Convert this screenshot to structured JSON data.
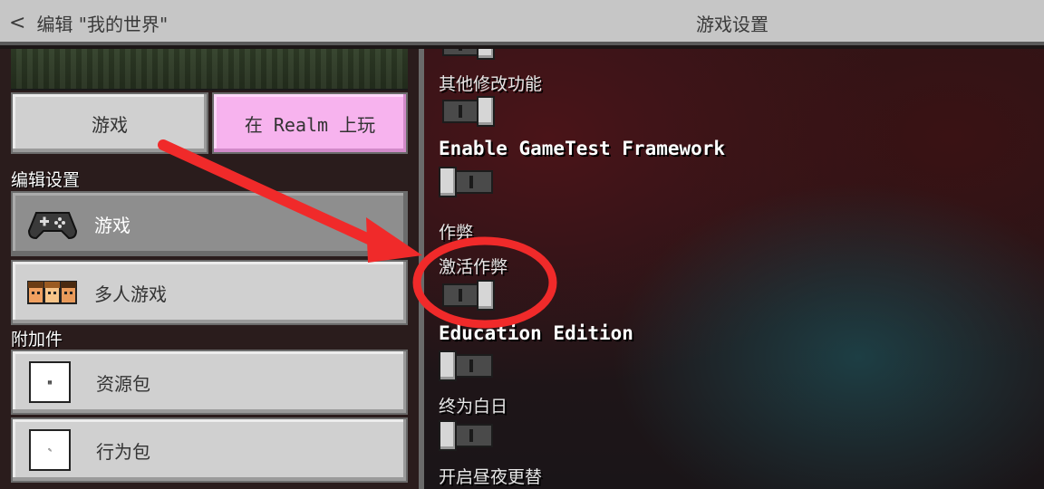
{
  "header": {
    "back_label": "编辑 \"我的世界\"",
    "title": "游戏设置"
  },
  "left": {
    "play_button": "游戏",
    "realm_button": "在 Realm 上玩",
    "edit_settings_label": "编辑设置",
    "nav": [
      {
        "label": "游戏",
        "icon": "controller-icon",
        "active": true
      },
      {
        "label": "多人游戏",
        "icon": "players-icon",
        "active": false
      }
    ],
    "addons_label": "附加件",
    "packs": [
      {
        "label": "资源包",
        "icon": "resource-pack-icon"
      },
      {
        "label": "行为包",
        "icon": "behavior-pack-icon"
      }
    ]
  },
  "settings": {
    "other_mods": "其他修改功能",
    "gametest": "Enable GameTest Framework",
    "cheats_section": "作弊",
    "activate_cheats": "激活作弊",
    "education": "Education Edition",
    "always_day": "终为白日",
    "daylight_cycle": "开启昼夜更替"
  },
  "toggles": {
    "other_mods": true,
    "gametest": false,
    "activate_cheats": true,
    "education": false,
    "always_day": false
  },
  "colors": {
    "annotation_red": "#f02a2a",
    "realm_pink": "#f7b3ee"
  }
}
